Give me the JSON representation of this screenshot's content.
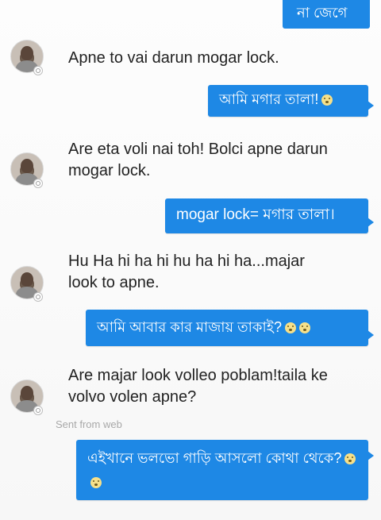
{
  "messages": {
    "partial_top": "না জেগে",
    "m1_in": "Apne to vai darun mogar lock.",
    "m2_out": "আমি মগার তালা!",
    "m3_in": "Are eta voli nai toh! Bolci apne darun mogar lock.",
    "m4_out": "mogar lock= মগার তালা।",
    "m5_in": "Hu Ha hi ha hi hu ha hi ha...majar look to apne.",
    "m6_out": "আমি আবার কার মাজায় তাকাই?",
    "m7_in": "Are majar look volleo poblam!taila ke volvo volen apne?",
    "m8_out": "এইখানে ভলভো গাড়ি আসলো কোথা থেকে?"
  },
  "meta": {
    "sent_from": "Sent from web"
  },
  "icons": {
    "avatar": "user-avatar-icon",
    "badge": "messenger-badge-icon",
    "emoji": "astonished-emoji-icon",
    "emoji2": "neutral-emoji-icon"
  }
}
